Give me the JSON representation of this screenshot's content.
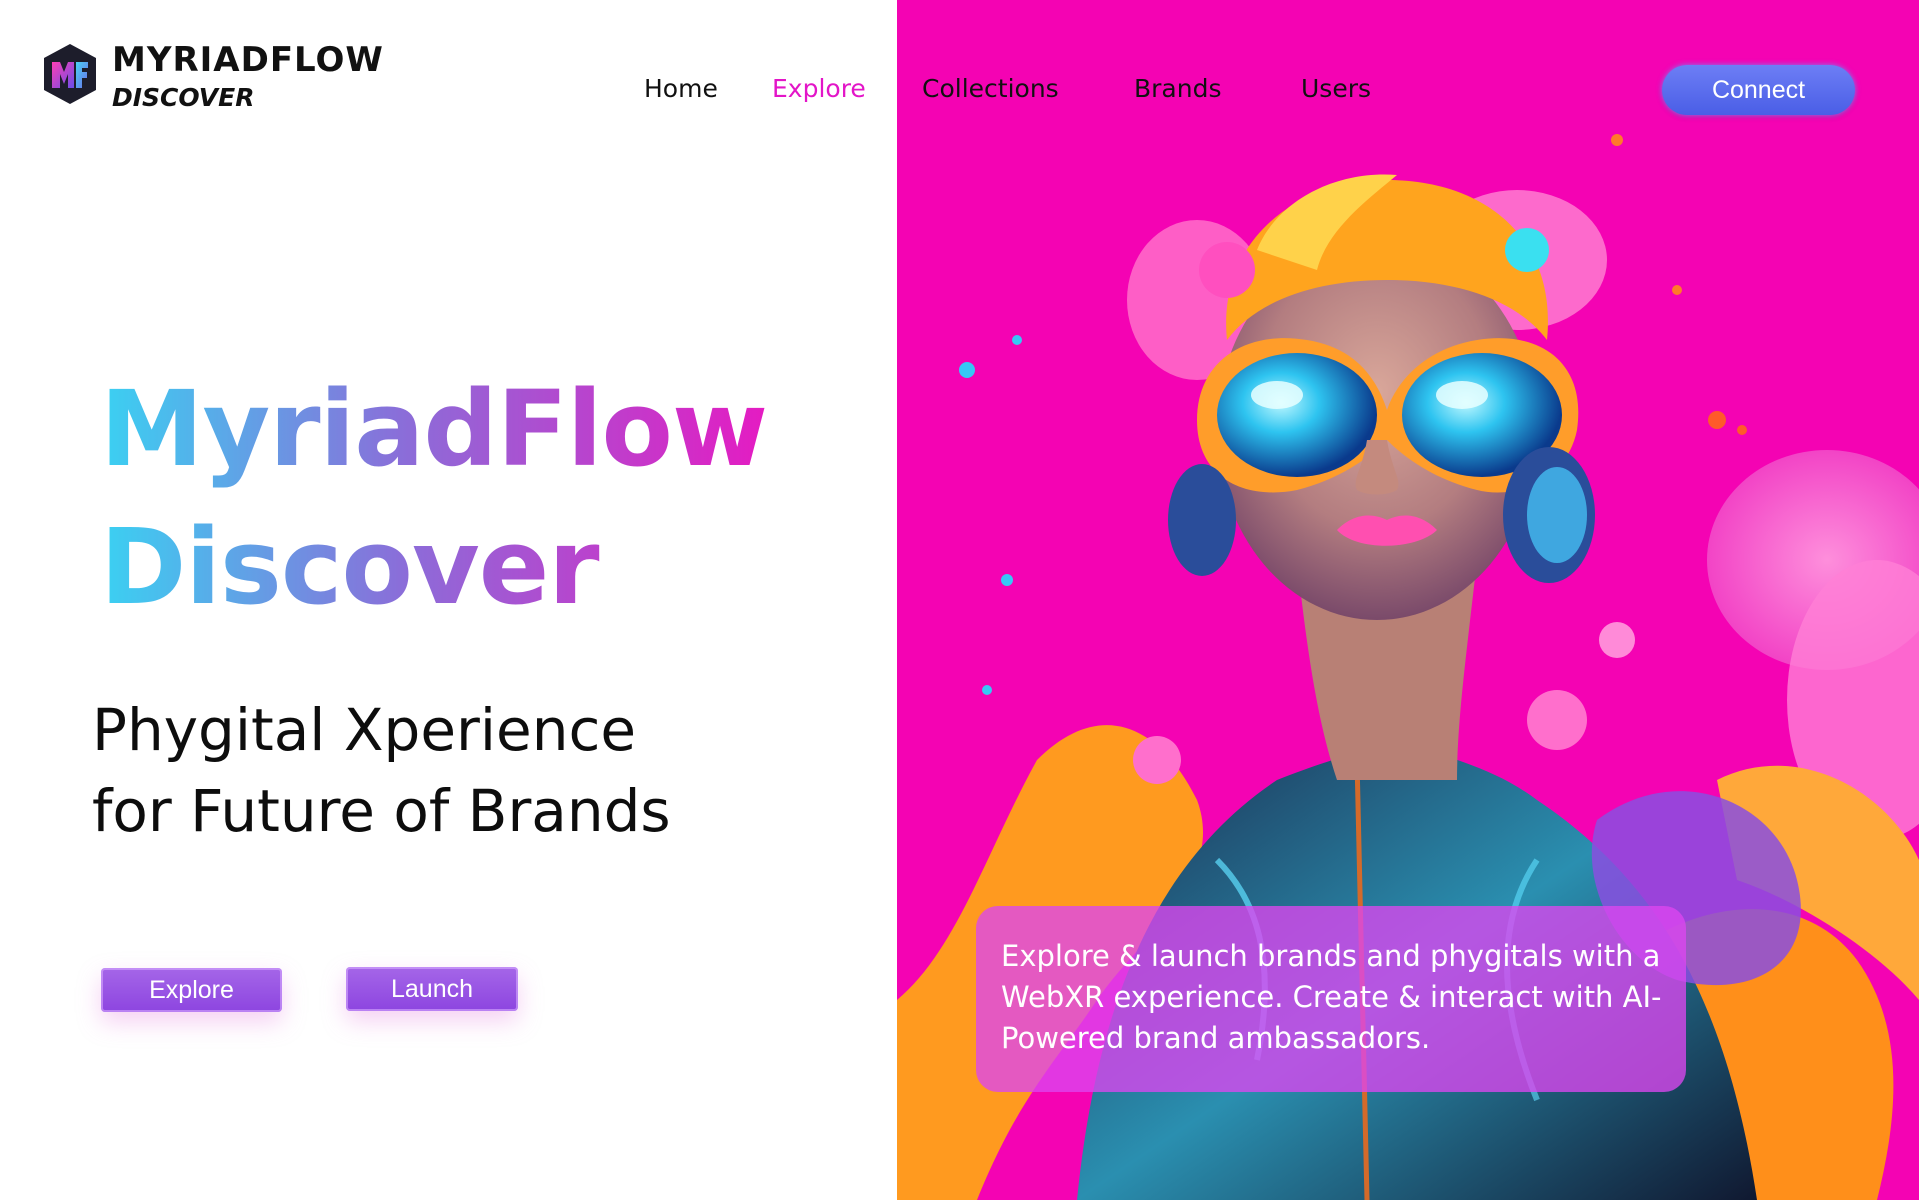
{
  "brand": {
    "name": "MYRIADFLOW",
    "sub": "DISCOVER",
    "logo_icon": "myriadflow-cube-logo"
  },
  "nav": {
    "items": [
      {
        "label": "Home",
        "active": false
      },
      {
        "label": "Explore",
        "active": true
      },
      {
        "label": "Collections",
        "active": false
      },
      {
        "label": "Brands",
        "active": false
      },
      {
        "label": "Users",
        "active": false
      }
    ],
    "connect_label": "Connect"
  },
  "hero": {
    "title_line1": "MyriadFlow",
    "title_line2": "Discover",
    "subtitle_line1": "Phygital Xperience",
    "subtitle_line2": "for Future of Brands",
    "buttons": {
      "explore": "Explore",
      "launch": "Launch"
    },
    "card_text": "Explore & launch brands and phygitals with a WebXR experience. Create & interact with AI-Powered brand ambassadors.",
    "image_subject": "woman-with-reflective-goggles-and-headphones-paint-splash"
  },
  "colors": {
    "panel_bg": "#f403b3",
    "active_nav": "#e315c8",
    "connect_btn": "#5a6ef0",
    "cta_btn": "#9a55e4",
    "title_gradient": [
      "#3ad1f2",
      "#8a6ed9",
      "#e51bc2"
    ]
  }
}
